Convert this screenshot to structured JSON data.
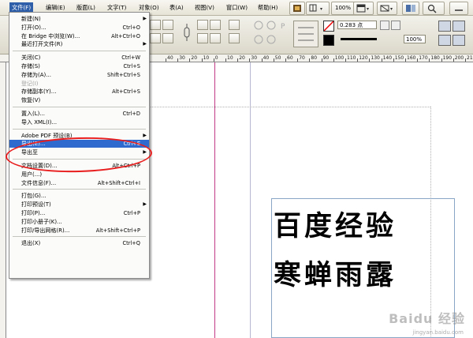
{
  "menubar": {
    "items": [
      "文件(F)",
      "编辑(E)",
      "版面(L)",
      "文字(T)",
      "对象(O)",
      "表(A)",
      "视图(V)",
      "窗口(W)",
      "帮助(H)"
    ],
    "zoom": "100%"
  },
  "control": {
    "stroke_weight": "0.283 点",
    "percent": "100%"
  },
  "ruler": {
    "ticks": [
      "40",
      "30",
      "20",
      "10",
      "0",
      "10",
      "20",
      "30",
      "40",
      "50",
      "60",
      "70",
      "80",
      "90",
      "100",
      "110",
      "120",
      "130",
      "140",
      "150",
      "160",
      "170",
      "180",
      "190",
      "200",
      "210"
    ]
  },
  "menu": {
    "items": [
      {
        "label": "新建(N)",
        "shortcut": "",
        "submenu": true
      },
      {
        "label": "打开(O)...",
        "shortcut": "Ctrl+O"
      },
      {
        "label": "在 Bridge 中浏览(W)...",
        "shortcut": "Alt+Ctrl+O"
      },
      {
        "label": "最近打开文件(R)",
        "shortcut": "",
        "submenu": true
      },
      {
        "label": "关闭(C)",
        "shortcut": "Ctrl+W"
      },
      {
        "label": "存储(S)",
        "shortcut": "Ctrl+S"
      },
      {
        "label": "存储为(A)...",
        "shortcut": "Shift+Ctrl+S"
      },
      {
        "label": "登记(I)",
        "shortcut": "",
        "disabled": true
      },
      {
        "label": "存储副本(Y)...",
        "shortcut": "Alt+Ctrl+S"
      },
      {
        "label": "恢复(V)",
        "shortcut": ""
      },
      {
        "label": "置入(L)...",
        "shortcut": "Ctrl+D"
      },
      {
        "label": "导入 XML(I)...",
        "shortcut": ""
      },
      {
        "label": "Adobe PDF 预设(B)",
        "shortcut": "",
        "submenu": true
      },
      {
        "label": "导出(E)...",
        "shortcut": "Ctrl+E",
        "highlighted": true
      },
      {
        "label": "导出至",
        "shortcut": "",
        "submenu": true
      },
      {
        "label": "文档设置(D)...",
        "shortcut": "Alt+Ctrl+P"
      },
      {
        "label": "用户(...)",
        "shortcut": ""
      },
      {
        "label": "文件信息(F)...",
        "shortcut": "Alt+Shift+Ctrl+I"
      },
      {
        "label": "打包(G)...",
        "shortcut": ""
      },
      {
        "label": "打印预设(T)",
        "shortcut": "",
        "submenu": true
      },
      {
        "label": "打印(P)...",
        "shortcut": "Ctrl+P"
      },
      {
        "label": "打印小册子(K)...",
        "shortcut": ""
      },
      {
        "label": "打印/导出网格(R)...",
        "shortcut": "Alt+Shift+Ctrl+P"
      },
      {
        "label": "退出(X)",
        "shortcut": "Ctrl+Q"
      }
    ]
  },
  "document": {
    "line1": "百度经验",
    "line2": "寒蝉雨露"
  },
  "watermark": {
    "brand": "Baidu 经验",
    "url": "jingyan.baidu.com"
  },
  "colors": {
    "highlight": "#2f6bcf",
    "annotation": "#e81d1d",
    "guide_magenta": "#c23a86",
    "guide_blue": "#8aa6c6"
  }
}
